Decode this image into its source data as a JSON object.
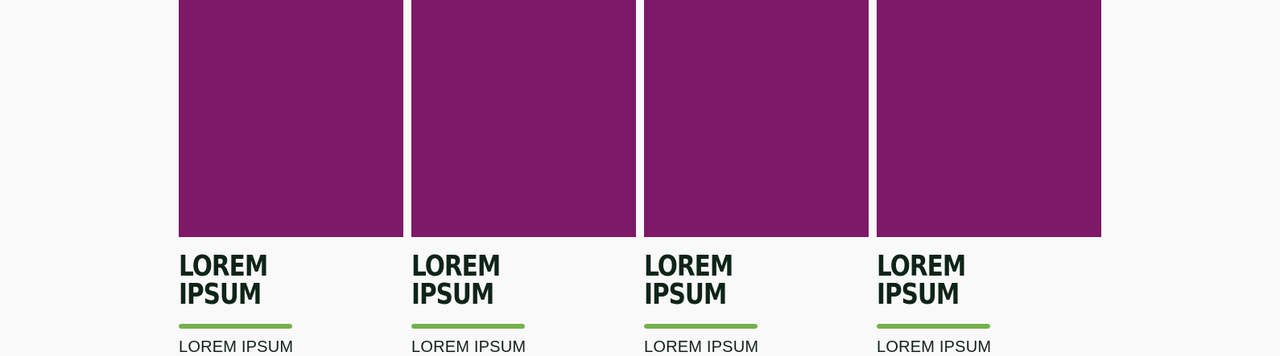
{
  "cards": [
    {
      "title_line1": "LOREM",
      "title_line2": "IPSUM",
      "subtitle": "LOREM IPSUM"
    },
    {
      "title_line1": "LOREM",
      "title_line2": "IPSUM",
      "subtitle": "LOREM IPSUM"
    },
    {
      "title_line1": "LOREM",
      "title_line2": "IPSUM",
      "subtitle": "LOREM IPSUM"
    },
    {
      "title_line1": "LOREM",
      "title_line2": "IPSUM",
      "subtitle": "LOREM IPSUM"
    }
  ],
  "colors": {
    "background": "#f9f9f9",
    "thumbnail": "#7d1966",
    "title": "#0f2419",
    "underline_accent": "#74b04a"
  }
}
